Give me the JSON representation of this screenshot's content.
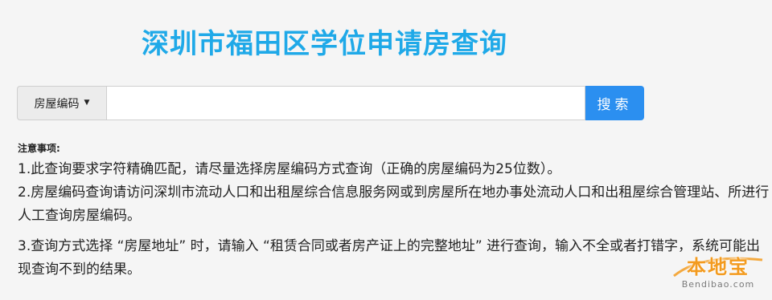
{
  "header": {
    "title": "深圳市福田区学位申请房查询"
  },
  "search": {
    "type_label": "房屋编码",
    "caret": "▼",
    "input_value": "",
    "input_placeholder": "",
    "button_label": "搜索"
  },
  "notes": {
    "heading": "注意事项:",
    "items": [
      "1.此查询要求字符精确匹配，请尽量选择房屋编码方式查询（正确的房屋编码为25位数）。",
      "2.房屋编码查询请访问深圳市流动人口和出租屋综合信息服务网或到房屋所在地办事处流动人口和出租屋综合管理站、所进行人工查询房屋编码。",
      "3.查询方式选择 “房屋地址” 时，请输入 “租赁合同或者房产证上的完整地址” 进行查询，输入不全或者打错字，系统可能出现查询不到的结果。"
    ]
  },
  "watermark": {
    "main": "本地宝",
    "site": "Bendibao.com",
    "color": "#f39b1f"
  },
  "colors": {
    "title": "#1fa9e8",
    "button": "#2b8ff0",
    "background": "#f5f5f5"
  }
}
